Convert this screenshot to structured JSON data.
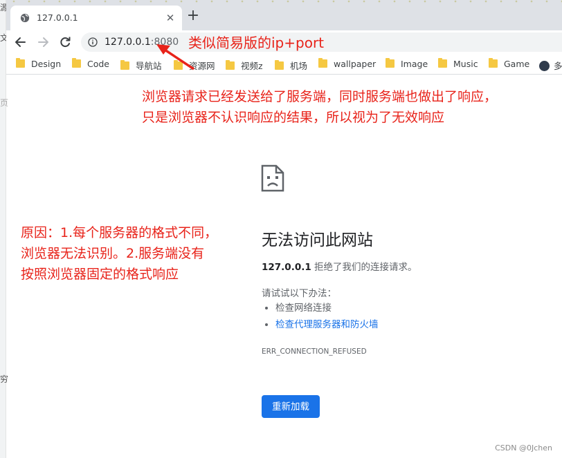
{
  "tab": {
    "title": "127.0.0.1",
    "close_glyph": "✕",
    "new_tab_glyph": "+"
  },
  "toolbar": {
    "url_host": "127.0.0.1",
    "url_port": ":8080"
  },
  "bookmarks": [
    {
      "label": "Design",
      "icon": "folder-icon"
    },
    {
      "label": "Code",
      "icon": "folder-icon"
    },
    {
      "label": "导航站",
      "icon": "folder-icon"
    },
    {
      "label": "资源网",
      "icon": "folder-icon"
    },
    {
      "label": "视频z",
      "icon": "folder-icon"
    },
    {
      "label": "机场",
      "icon": "folder-icon"
    },
    {
      "label": "wallpaper",
      "icon": "folder-icon"
    },
    {
      "label": "Image",
      "icon": "folder-icon"
    },
    {
      "label": "Music",
      "icon": "folder-icon"
    },
    {
      "label": "Game",
      "icon": "folder-icon"
    },
    {
      "label": "多",
      "icon": "avatar-icon"
    }
  ],
  "error": {
    "title": "无法访问此网站",
    "host": "127.0.0.1",
    "desc_suffix": " 拒绝了我们的连接请求。",
    "try_text": "请试试以下办法：",
    "suggestions": [
      "检查网络连接",
      "检查代理服务器和防火墙"
    ],
    "code": "ERR_CONNECTION_REFUSED",
    "reload_label": "重新加载"
  },
  "annotations": {
    "a1": "类似简易版的ip+port",
    "a2_line1": "浏览器请求已经发送给了服务端，同时服务端也做出了响应，",
    "a2_line2": "只是浏览器不认识响应的结果，所以视为了无效响应",
    "a3_line1": "原因：1.每个服务器的格式不同，",
    "a3_line2": "浏览器无法识别。2.服务端没有",
    "a3_line3": "按照浏览器固定的格式响应"
  },
  "background_window": {
    "glyphs": [
      "源",
      "文",
      "页",
      "穷"
    ]
  },
  "watermark": "CSDN @0Jchen",
  "colors": {
    "annotation": "#e8231a",
    "accent": "#1a73e8",
    "folder": "#f5c842"
  }
}
